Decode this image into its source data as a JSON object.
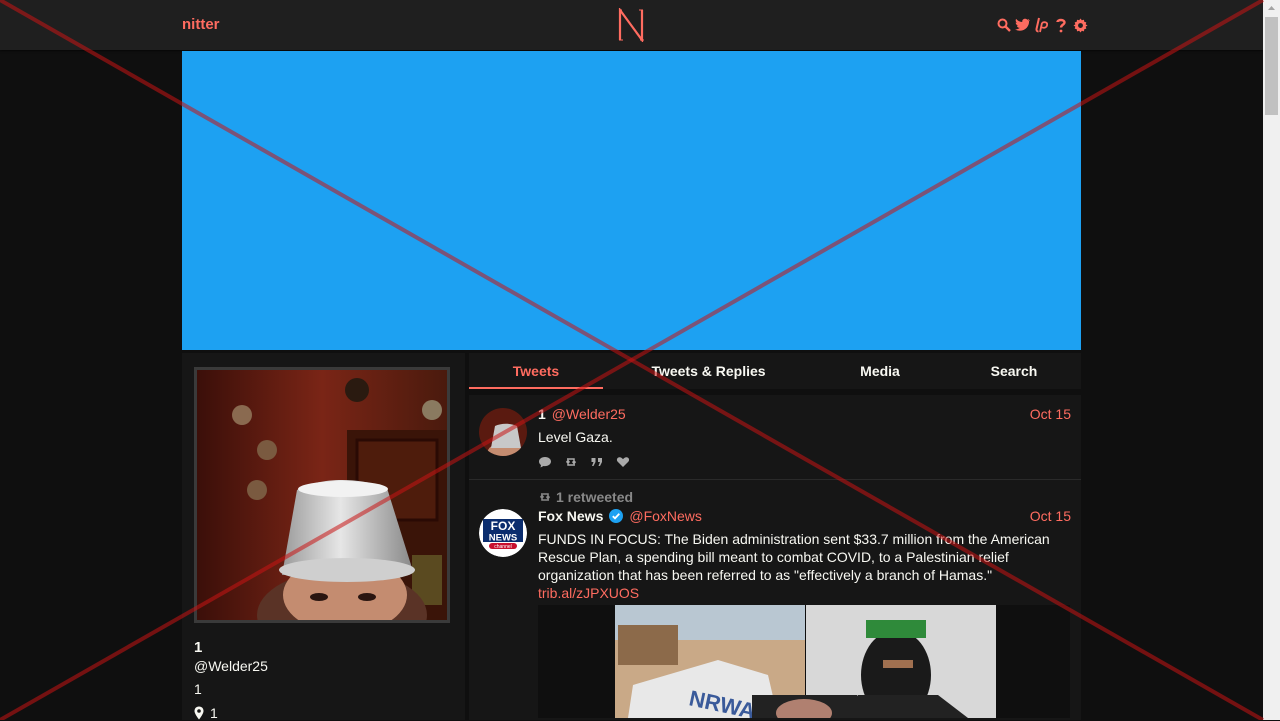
{
  "brand": "nitter",
  "nav": [
    "search-icon",
    "twitter-bird-icon",
    "liberapay-icon",
    "help-icon",
    "settings-gear-icon"
  ],
  "colors": {
    "accent": "#ff6c60",
    "banner": "#1da1f2",
    "bg": "#0f0f0f",
    "panel": "#161616",
    "topbar": "#1f1f1f"
  },
  "profile": {
    "name": "1",
    "handle": "@Welder25",
    "bio": "1",
    "location": "1"
  },
  "tabs": [
    {
      "label": "Tweets",
      "active": true
    },
    {
      "label": "Tweets & Replies",
      "active": false
    },
    {
      "label": "Media",
      "active": false
    },
    {
      "label": "Search",
      "active": false
    }
  ],
  "tweets": [
    {
      "name": "1",
      "username": "@Welder25",
      "date": "Oct 15",
      "text": "Level Gaza."
    },
    {
      "retweet_header": "1 retweeted",
      "name": "Fox News",
      "username": "@FoxNews",
      "date": "Oct 15",
      "text": "FUNDS IN FOCUS: The Biden administration sent $33.7 million from the American Rescue Plan, a spending bill meant to combat COVID, to a Palestinian relief organization that has been referred to as \"effectively a branch of Hamas.\"",
      "link": "trib.al/zJPXUOS"
    }
  ]
}
